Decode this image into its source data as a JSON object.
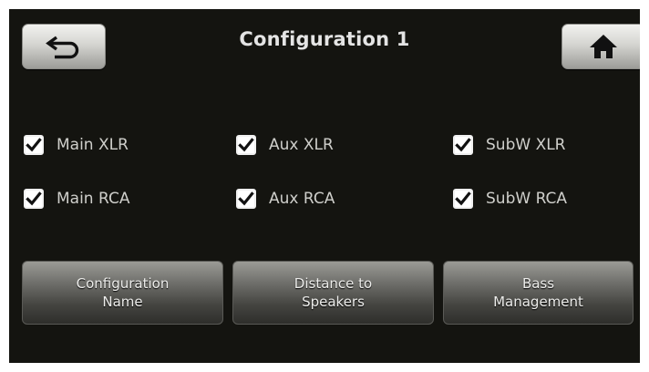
{
  "header": {
    "title": "Configuration 1",
    "back_icon": "back-arrow-icon",
    "home_icon": "home-icon"
  },
  "outputs": [
    {
      "label": "Main XLR",
      "checked": true
    },
    {
      "label": "Aux XLR",
      "checked": true
    },
    {
      "label": "SubW XLR",
      "checked": true
    },
    {
      "label": "Main RCA",
      "checked": true
    },
    {
      "label": "Aux RCA",
      "checked": true
    },
    {
      "label": "SubW RCA",
      "checked": true
    }
  ],
  "buttons": {
    "config_name": {
      "line1": "Configuration",
      "line2": "Name"
    },
    "distance": {
      "line1": "Distance to",
      "line2": "Speakers"
    },
    "bass": {
      "line1": "Bass",
      "line2": "Management"
    }
  },
  "colors": {
    "background": "#141410",
    "text": "#cfcfcb",
    "button_gradient_top": "#9b9b96",
    "button_gradient_bottom": "#2e2e2b"
  }
}
